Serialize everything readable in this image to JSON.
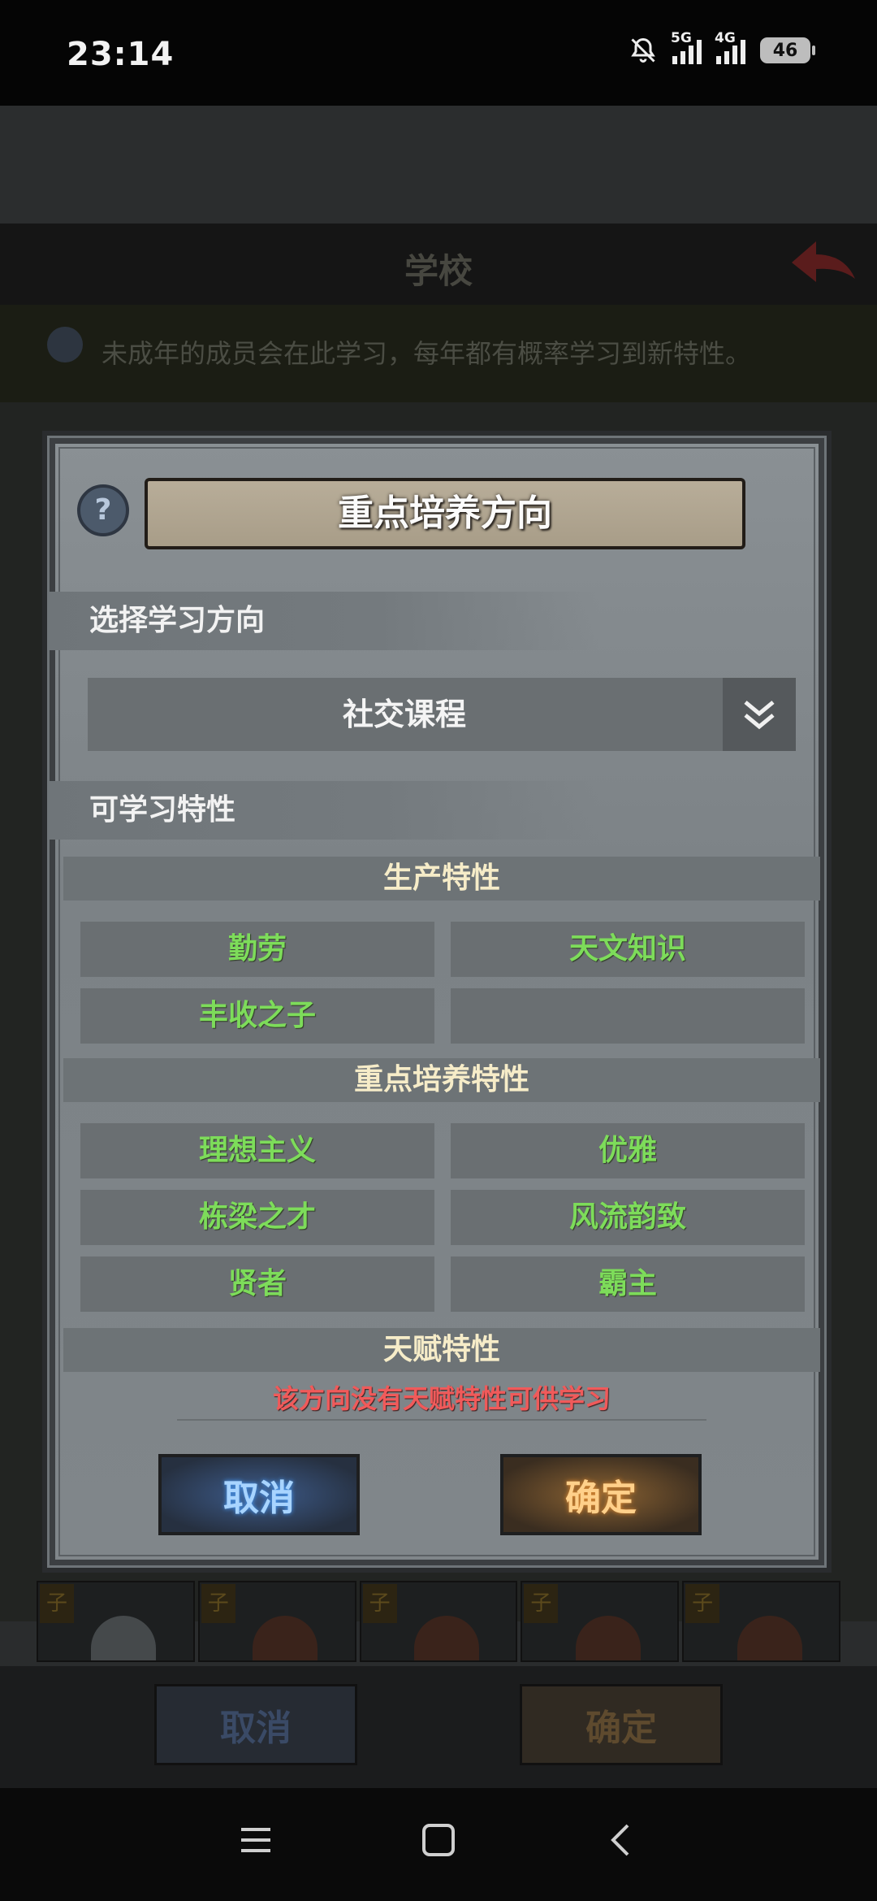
{
  "status_bar": {
    "time": "23:14",
    "signal_1_label": "5G",
    "signal_2_label": "4G",
    "battery": "46"
  },
  "background": {
    "title": "学校",
    "info_text": "未成年的成员会在此学习，每年都有概率学习到新特性。",
    "cancel_label": "取消",
    "confirm_label": "确定",
    "portrait_badge": "子"
  },
  "dialog": {
    "title": "重点培养方向",
    "direction_section_label": "选择学习方向",
    "selected_direction": "社交课程",
    "traits_section_label": "可学习特性",
    "categories": [
      {
        "name": "生产特性",
        "traits": [
          "勤劳",
          "天文知识",
          "丰收之子",
          ""
        ]
      },
      {
        "name": "重点培养特性",
        "traits": [
          "理想主义",
          "优雅",
          "栋梁之才",
          "风流韵致",
          "贤者",
          "霸主"
        ]
      },
      {
        "name": "天赋特性",
        "traits": []
      }
    ],
    "no_talent_message": "该方向没有天赋特性可供学习",
    "cancel_label": "取消",
    "confirm_label": "确定"
  },
  "colors": {
    "trait_text": "#7ddc5a",
    "category_text": "#f6ecc8",
    "warning_text": "#f05a5a",
    "cancel_glow": "#a8d4ff",
    "confirm_glow": "#ffd08a"
  },
  "icons": {
    "help": "question-mark-icon",
    "dropdown": "double-chevron-down-icon",
    "back": "red-back-arrow-icon",
    "nav_recents": "menu-lines-icon",
    "nav_home": "square-icon",
    "nav_back": "chevron-left-icon"
  }
}
